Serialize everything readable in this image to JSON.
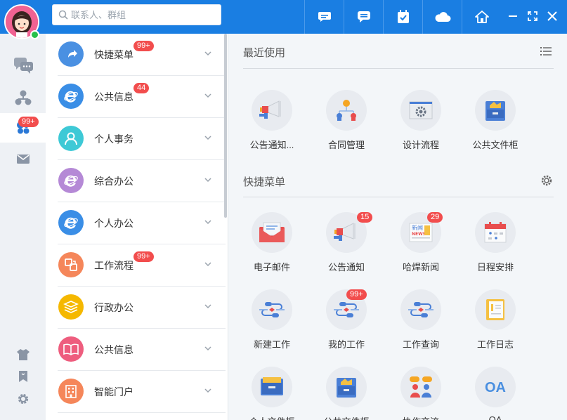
{
  "search": {
    "placeholder": "联系人、群组"
  },
  "colors": {
    "accent": "#1a7ee2",
    "badge": "#f24d4d",
    "online": "#25c04a"
  },
  "toolbar": {
    "buttons": [
      {
        "name": "chat-toolbar-button",
        "icon": "chat-bubble-icon"
      },
      {
        "name": "messages-toolbar-button",
        "icon": "message-square-icon"
      },
      {
        "name": "calendar-toolbar-button",
        "icon": "calendar-check-icon"
      },
      {
        "name": "cloud-toolbar-button",
        "icon": "cloud-icon"
      },
      {
        "name": "home-toolbar-button",
        "icon": "home-icon"
      }
    ]
  },
  "rail": {
    "apps_badge": "99+",
    "items": [
      "chat-icon",
      "org-chart-icon",
      "apps-icon",
      "mail-icon",
      "theme-shirt-icon",
      "bookmark-icon",
      "settings-gear-icon"
    ]
  },
  "menu": {
    "items": [
      {
        "label": "快捷菜单",
        "badge": "99+",
        "icon": "share-arrow-icon",
        "color": "#4a90e2"
      },
      {
        "label": "公共信息",
        "badge": "44",
        "icon": "ie-icon",
        "color": "#3a8ee6"
      },
      {
        "label": "个人事务",
        "badge": "",
        "icon": "person-icon",
        "color": "#3ec9d6"
      },
      {
        "label": "综合办公",
        "badge": "",
        "icon": "ie-icon",
        "color": "#b589d6"
      },
      {
        "label": "个人办公",
        "badge": "",
        "icon": "ie-icon",
        "color": "#3a8ee6"
      },
      {
        "label": "工作流程",
        "badge": "99+",
        "icon": "workflow-icon",
        "color": "#f5865a"
      },
      {
        "label": "行政办公",
        "badge": "",
        "icon": "layers-icon",
        "color": "#f5b800"
      },
      {
        "label": "公共信息",
        "badge": "",
        "icon": "book-icon",
        "color": "#ee5d7e"
      },
      {
        "label": "智能门户",
        "badge": "",
        "icon": "building-icon",
        "color": "#f5865a"
      }
    ]
  },
  "recent": {
    "title": "最近使用",
    "apps": [
      {
        "label": "公告通知...",
        "icon": "megaphone-icon",
        "badge": ""
      },
      {
        "label": "合同管理",
        "icon": "hierarchy-icon",
        "badge": ""
      },
      {
        "label": "设计流程",
        "icon": "design-gear-icon",
        "badge": ""
      },
      {
        "label": "公共文件柜",
        "icon": "file-cabinet-icon",
        "badge": ""
      }
    ]
  },
  "shortcuts": {
    "title": "快捷菜单",
    "apps": [
      {
        "label": "电子邮件",
        "icon": "envelope-icon",
        "badge": ""
      },
      {
        "label": "公告通知",
        "icon": "megaphone-icon",
        "badge": "15"
      },
      {
        "label": "哈焊新闻",
        "icon": "newspaper-icon",
        "badge": "29"
      },
      {
        "label": "日程安排",
        "icon": "calendar-icon",
        "badge": ""
      },
      {
        "label": "新建工作",
        "icon": "flow-icon",
        "badge": ""
      },
      {
        "label": "我的工作",
        "icon": "flow-icon",
        "badge": "99+"
      },
      {
        "label": "工作查询",
        "icon": "flow-icon",
        "badge": ""
      },
      {
        "label": "工作日志",
        "icon": "notebook-icon",
        "badge": ""
      },
      {
        "label": "个人文件柜",
        "icon": "drawer-icon",
        "badge": ""
      },
      {
        "label": "公共文件柜",
        "icon": "file-cabinet-icon",
        "badge": ""
      },
      {
        "label": "协作交流",
        "icon": "people-chat-icon",
        "badge": ""
      },
      {
        "label": "OA",
        "icon": "oa-text-icon",
        "badge": ""
      }
    ]
  }
}
